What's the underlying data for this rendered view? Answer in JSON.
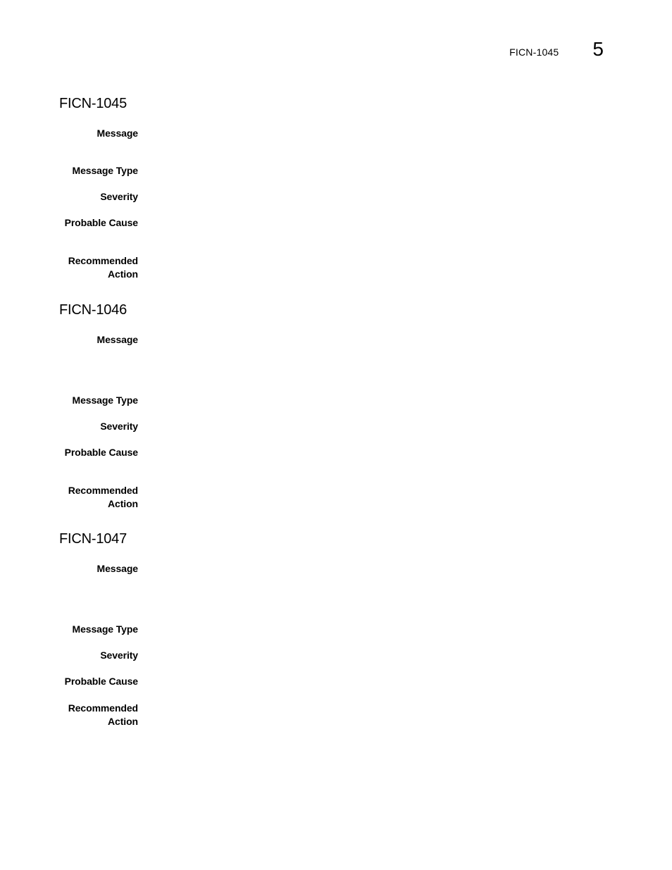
{
  "header": {
    "running_title": "FICN-1045",
    "chapter_number": "5"
  },
  "sections": [
    {
      "title": "FICN-1045",
      "fields": [
        {
          "label": "Message",
          "value": ""
        },
        {
          "label": "Message Type",
          "value": ""
        },
        {
          "label": "Severity",
          "value": ""
        },
        {
          "label": "Probable Cause",
          "value": ""
        },
        {
          "label_lines": [
            "Recommended",
            "Action"
          ],
          "value": ""
        }
      ]
    },
    {
      "title": "FICN-1046",
      "fields": [
        {
          "label": "Message",
          "value": ""
        },
        {
          "label": "Message Type",
          "value": ""
        },
        {
          "label": "Severity",
          "value": ""
        },
        {
          "label": "Probable Cause",
          "value": ""
        },
        {
          "label_lines": [
            "Recommended",
            "Action"
          ],
          "value": ""
        }
      ]
    },
    {
      "title": "FICN-1047",
      "fields": [
        {
          "label": "Message",
          "value": ""
        },
        {
          "label": "Message Type",
          "value": ""
        },
        {
          "label": "Severity",
          "value": ""
        },
        {
          "label": "Probable Cause",
          "value": ""
        },
        {
          "label_lines": [
            "Recommended",
            "Action"
          ],
          "value": ""
        }
      ]
    }
  ]
}
